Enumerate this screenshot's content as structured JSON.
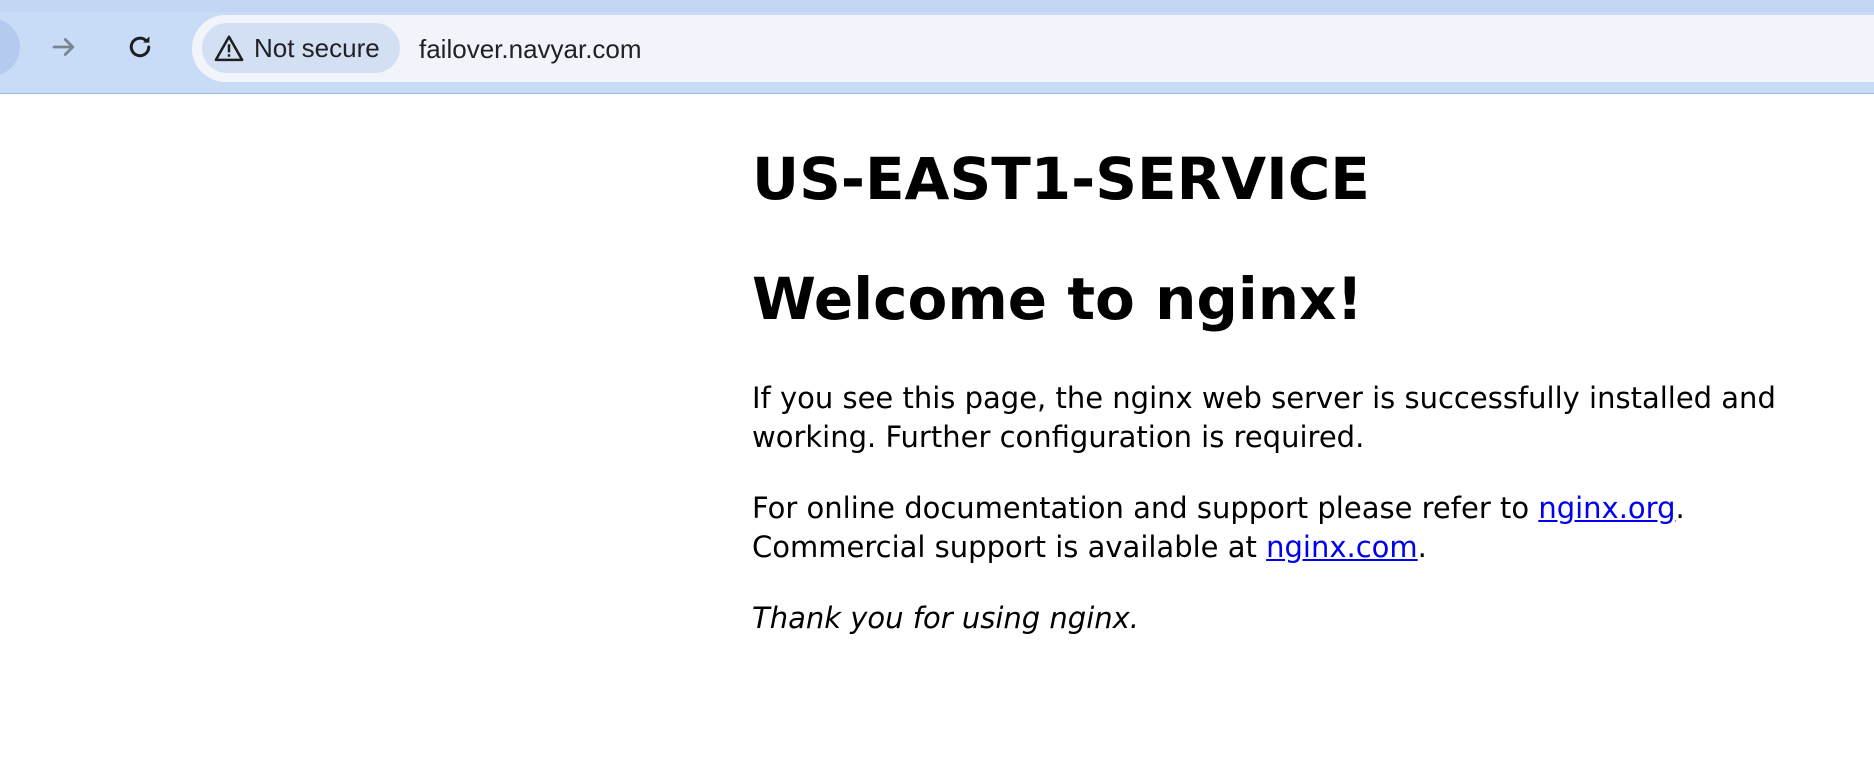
{
  "browser": {
    "security_label": "Not secure",
    "url": "failover.navyar.com",
    "icons": {
      "back": "arrow-left-icon",
      "forward": "arrow-right-icon",
      "reload": "reload-icon",
      "security": "warning-triangle-icon"
    },
    "colors": {
      "toolbar": "#c9dcf7",
      "omnibox": "#f1f5fb",
      "chip": "#d3e0f3"
    }
  },
  "page": {
    "service_title": "US-EAST1-SERVICE",
    "welcome_title": "Welcome to nginx!",
    "paragraph1": "If you see this page, the nginx web server is successfully installed and working. Further configuration is required.",
    "paragraph2_prefix": "For online documentation and support please refer to ",
    "link_org": "nginx.org",
    "paragraph2_middle": ". Commercial support is available at ",
    "link_com": "nginx.com",
    "paragraph2_suffix": ".",
    "thanks": "Thank you for using nginx.",
    "colors": {
      "link": "#0000ee",
      "text": "#000000"
    }
  }
}
